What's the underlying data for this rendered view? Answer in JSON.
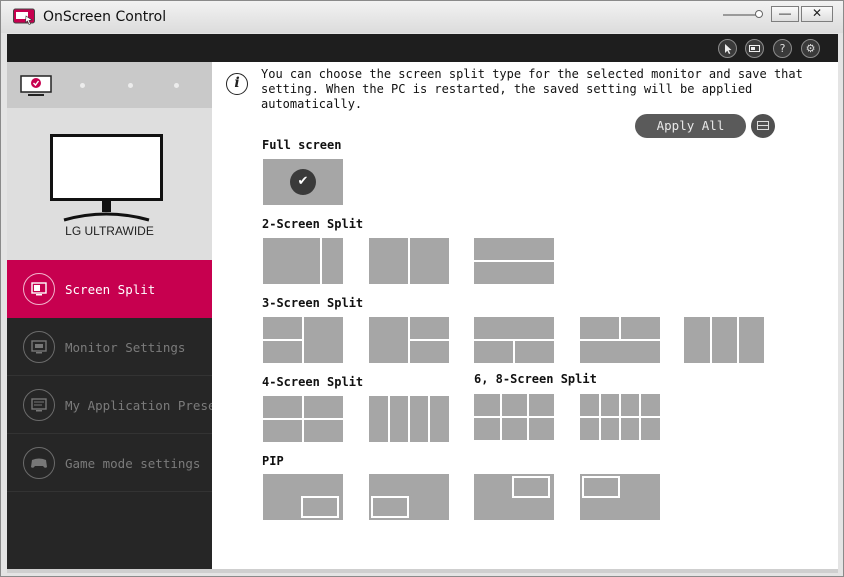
{
  "window": {
    "title": "OnScreen Control",
    "minimize_label": "—",
    "close_label": "✕"
  },
  "toolbar": {
    "icons": [
      "cursor-icon",
      "battery-icon",
      "help-icon",
      "settings-icon"
    ],
    "help_glyph": "?",
    "settings_glyph": "⚙"
  },
  "sidebar": {
    "monitor_name": "LG ULTRAWIDE",
    "nav_items": [
      {
        "label": "Screen Split",
        "active": true
      },
      {
        "label": "Monitor Settings",
        "active": false
      },
      {
        "label": "My Application Preset",
        "active": false
      },
      {
        "label": "Game mode settings",
        "active": false
      }
    ]
  },
  "main": {
    "description": "You can choose the screen split type for the selected monitor and save that setting. When the PC is restarted, the saved setting will be applied automatically.",
    "apply_all_label": "Apply All",
    "sections": {
      "full_screen": "Full screen",
      "two_split": "2-Screen Split",
      "three_split": "3-Screen Split",
      "four_split": "4-Screen Split",
      "six_eight_split": "6, 8-Screen Split",
      "pip": "PIP"
    },
    "selected_check": "✔"
  },
  "colors": {
    "accent": "#c7004f",
    "sidebar_bg": "#262626",
    "thumb": "#a6a6a6"
  }
}
